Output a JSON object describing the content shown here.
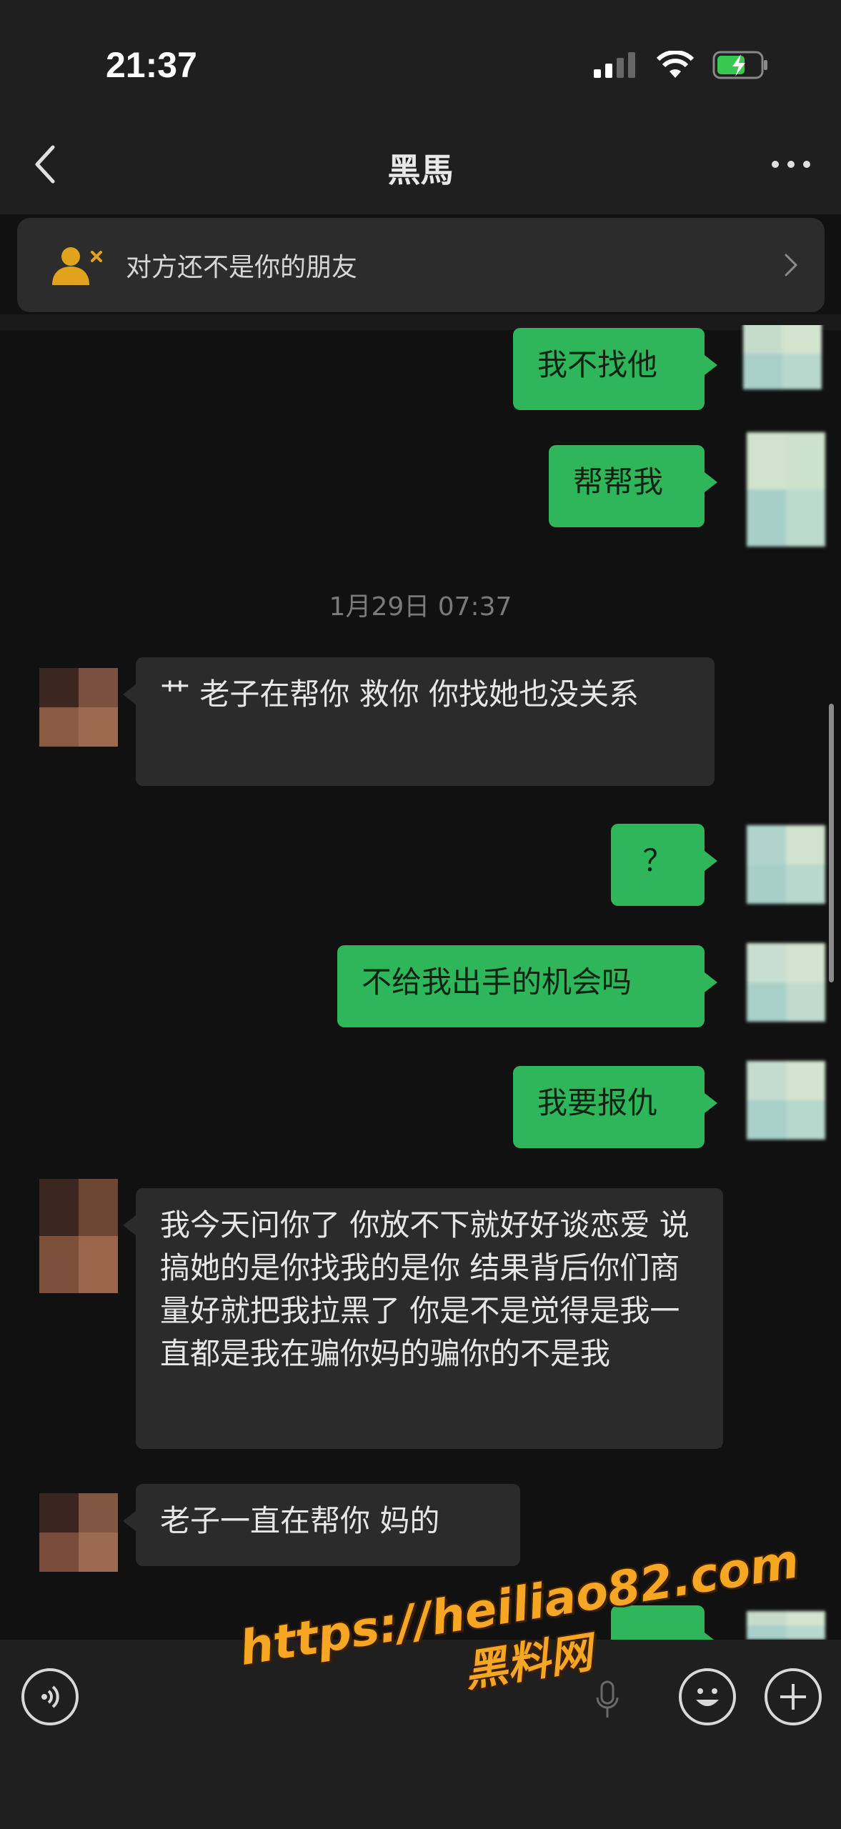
{
  "status_bar": {
    "time": "21:37"
  },
  "nav": {
    "title": "黑馬"
  },
  "notice": {
    "text": "对方还不是你的朋友"
  },
  "messages": [
    {
      "side": "sent",
      "text": "我不找他"
    },
    {
      "side": "sent",
      "text": "帮帮我"
    },
    {
      "timestamp": "1月29日 07:37"
    },
    {
      "side": "received",
      "text": "艹 老子在帮你 救你  你找她也没关系"
    },
    {
      "side": "sent",
      "text": "？"
    },
    {
      "side": "sent",
      "text": "不给我出手的机会吗"
    },
    {
      "side": "sent",
      "text": "我要报仇"
    },
    {
      "side": "received",
      "text": "我今天问你了 你放不下就好好谈恋爱 说搞她的是你找我的是你 结果背后你们商量好就把我拉黑了  你是不是觉得是我一直都是我在骗你妈的骗你的不是我"
    },
    {
      "side": "received",
      "text": "老子一直在帮你 妈的"
    }
  ],
  "watermark": {
    "url": "https://heiliao82.com",
    "name": "黑料网"
  },
  "colors": {
    "sent_bubble": "#2fb55a",
    "received_bubble": "#2b2b2b",
    "accent_icon": "#e0a31c",
    "watermark": "#f5a623"
  },
  "icons": [
    "back-chevron",
    "more-dots",
    "user-not-friend",
    "chevron-right",
    "voice",
    "microphone",
    "emoji",
    "plus"
  ]
}
